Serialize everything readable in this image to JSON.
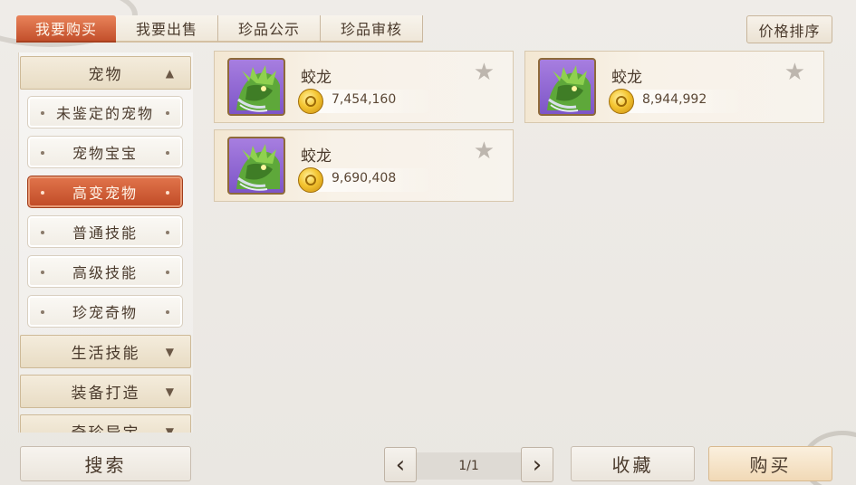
{
  "tabs": [
    {
      "label": "我要购买",
      "active": true
    },
    {
      "label": "我要出售",
      "active": false
    },
    {
      "label": "珍品公示",
      "active": false
    },
    {
      "label": "珍品审核",
      "active": false
    }
  ],
  "sort_button": "价格排序",
  "sidebar": {
    "category_open": {
      "label": "宠物",
      "arrow": "▲"
    },
    "subitems": [
      {
        "label": "未鉴定的宠物",
        "active": false
      },
      {
        "label": "宠物宝宝",
        "active": false
      },
      {
        "label": "高变宠物",
        "active": true
      },
      {
        "label": "普通技能",
        "active": false
      },
      {
        "label": "高级技能",
        "active": false
      },
      {
        "label": "珍宠奇物",
        "active": false
      }
    ],
    "categories_closed": [
      {
        "label": "生活技能",
        "arrow": "▼"
      },
      {
        "label": "装备打造",
        "arrow": "▼"
      },
      {
        "label": "奇珍异宝",
        "arrow": "▼"
      }
    ]
  },
  "listings": [
    {
      "name": "蛟龙",
      "price": "7,454,160",
      "favorited": false
    },
    {
      "name": "蛟龙",
      "price": "8,944,992",
      "favorited": false
    },
    {
      "name": "蛟龙",
      "price": "9,690,408",
      "favorited": false
    }
  ],
  "star_glyph": "★",
  "pager": {
    "prev": "‹",
    "next": "›",
    "page_text": "1/1"
  },
  "buttons": {
    "search": "搜索",
    "favorites": "收藏",
    "buy": "购买"
  },
  "colors": {
    "accent": "#c85430",
    "card_bg": "#f4e9d7",
    "pet_bg": "#8f66d4"
  }
}
